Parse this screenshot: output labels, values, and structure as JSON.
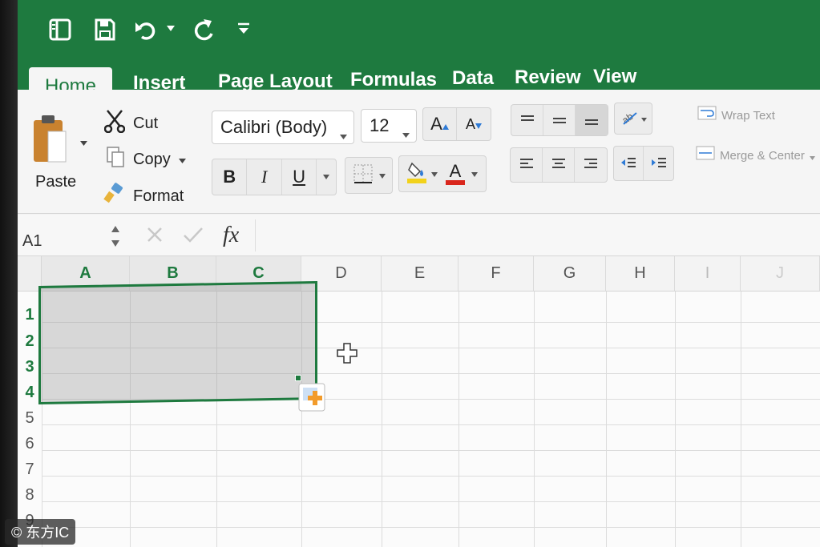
{
  "tabs": [
    "Home",
    "Insert",
    "Page Layout",
    "Formulas",
    "Data",
    "Review",
    "View"
  ],
  "clipboard": {
    "paste": "Paste",
    "cut": "Cut",
    "copy": "Copy",
    "format": "Format"
  },
  "font": {
    "name": "Calibri (Body)",
    "size": "12",
    "bold": "B",
    "italic": "I",
    "underline": "U",
    "grow": "A",
    "shrink": "A",
    "font_color_letter": "A"
  },
  "alignment": {
    "wrap_text": "Wrap Text",
    "merge_center": "Merge & Center"
  },
  "formula_bar": {
    "name_box": "A1",
    "fx": "fx"
  },
  "columns": [
    "A",
    "B",
    "C",
    "D",
    "E",
    "F",
    "G",
    "H",
    "I",
    "J"
  ],
  "rows": [
    "1",
    "2",
    "3",
    "4",
    "5",
    "6",
    "7",
    "8",
    "9"
  ],
  "watermark": "© 东方IC",
  "colors": {
    "accent": "#1e7a3f",
    "highlight_yellow": "#f2d21b",
    "font_red": "#d9261c"
  }
}
